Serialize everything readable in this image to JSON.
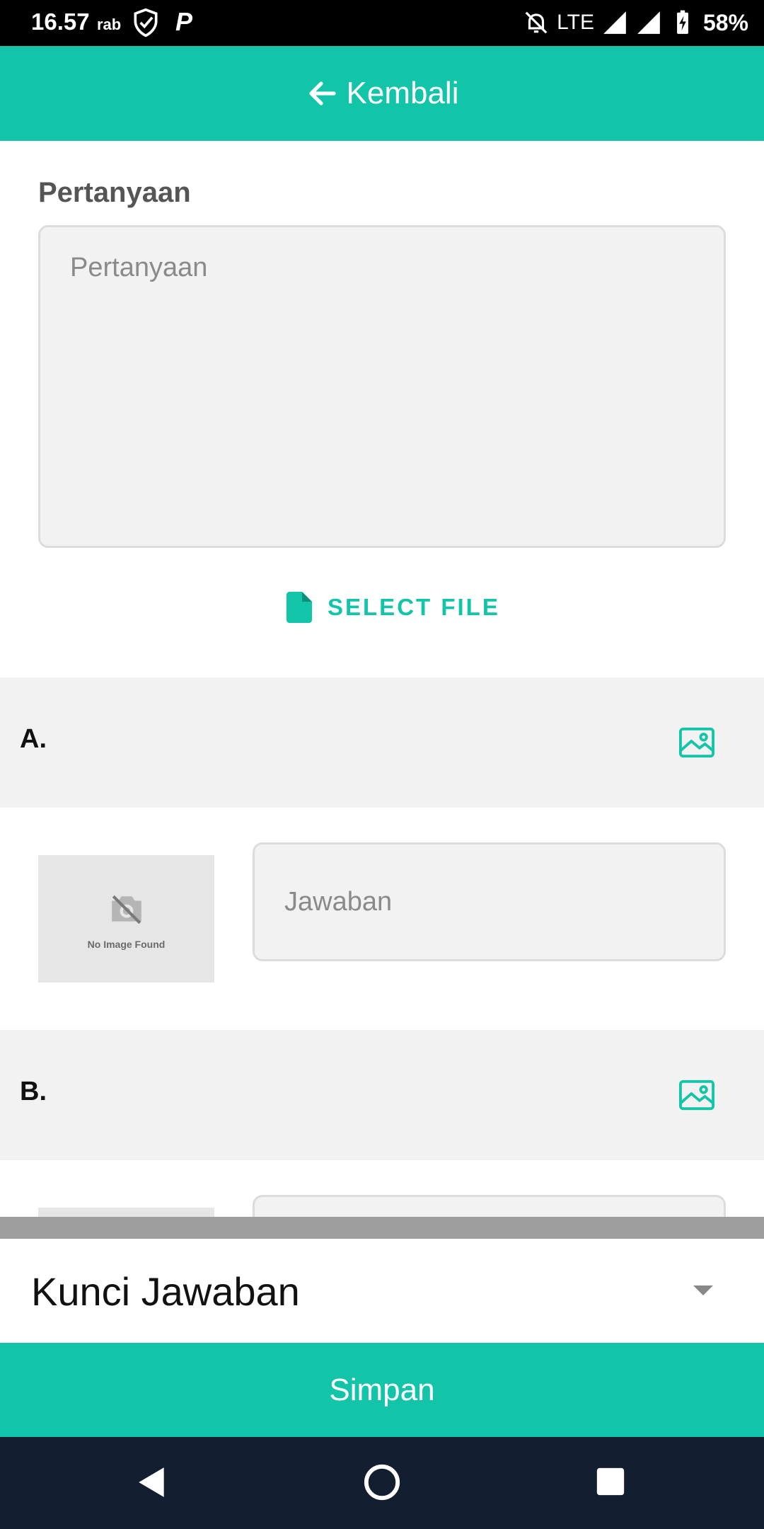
{
  "status_bar": {
    "time": "16.57",
    "day": "rab",
    "carrier_icon": "P",
    "network": "LTE",
    "battery": "58%"
  },
  "header": {
    "back_label": "Kembali"
  },
  "question": {
    "label": "Pertanyaan",
    "placeholder": "Pertanyaan",
    "select_file_label": "SELECT FILE"
  },
  "options": [
    {
      "letter": "A.",
      "thumb_text": "No Image Found",
      "answer_placeholder": "Jawaban"
    },
    {
      "letter": "B."
    }
  ],
  "answer_key": {
    "label": "Kunci Jawaban"
  },
  "save_label": "Simpan",
  "colors": {
    "accent": "#12c4a8",
    "nav_bar": "#131e30"
  }
}
